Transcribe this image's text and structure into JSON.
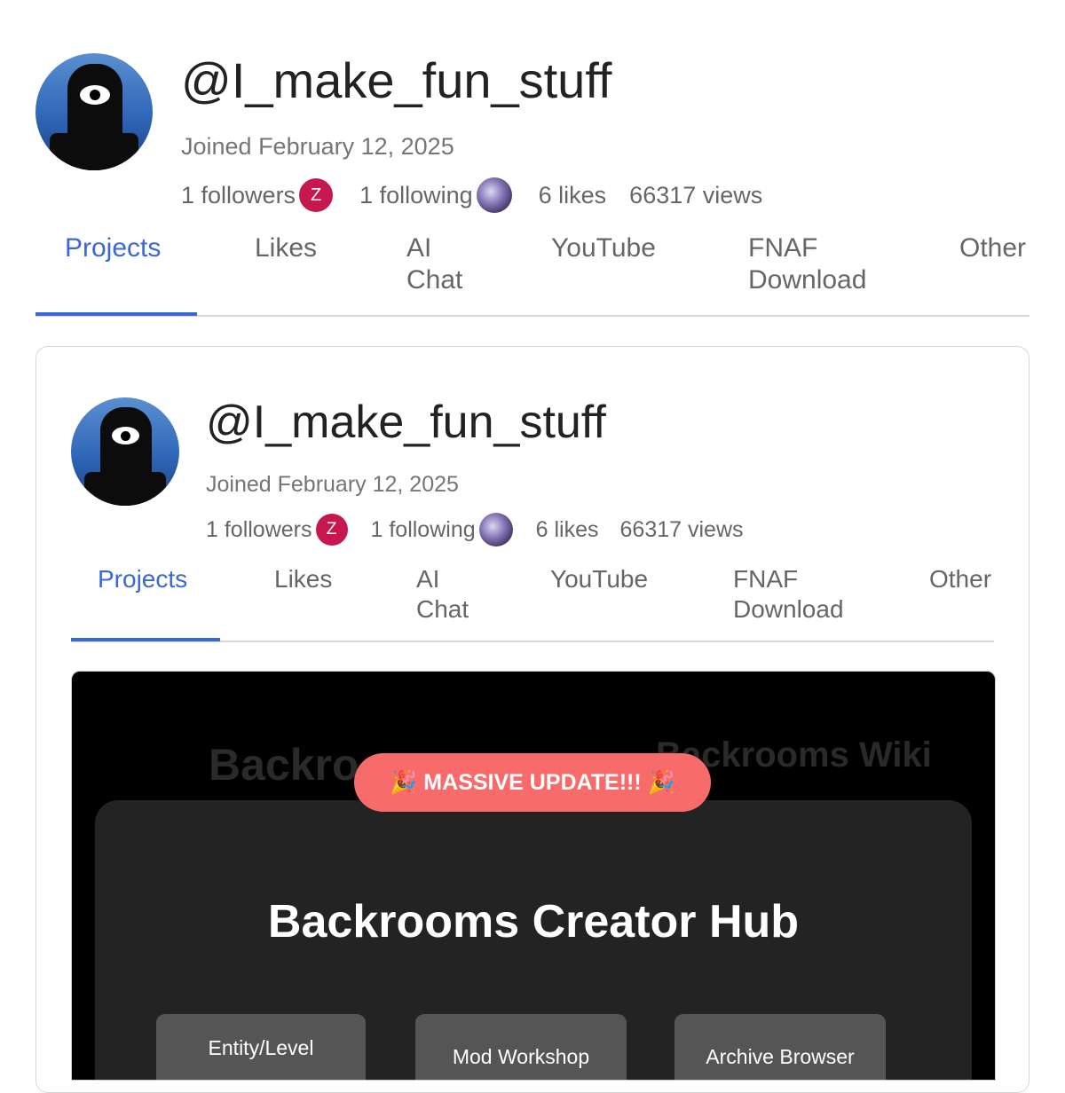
{
  "profile": {
    "handle": "@I_make_fun_stuff",
    "joined": "Joined February 12, 2025",
    "followers": "1 followers",
    "follower_badge": "Z",
    "following": "1 following",
    "likes": "6 likes",
    "views": "66317 views"
  },
  "tabs": [
    {
      "label": "Projects",
      "active": true
    },
    {
      "label": "Likes"
    },
    {
      "label": "AI\nChat"
    },
    {
      "label": "YouTube"
    },
    {
      "label": "FNAF\nDownload"
    },
    {
      "label": "Other"
    }
  ],
  "colors": {
    "accent": "#3a68d6",
    "badge": "#c7174f",
    "pill": "#f76b6b"
  },
  "thumbnail": {
    "ghost_left": "Backro",
    "ghost_right": "Backrooms Wiki",
    "pill": "🎉 MASSIVE UPDATE!!! 🎉",
    "title": "Backrooms Creator Hub",
    "buttons": [
      "Entity/Level",
      "Mod Workshop",
      "Archive Browser"
    ]
  }
}
